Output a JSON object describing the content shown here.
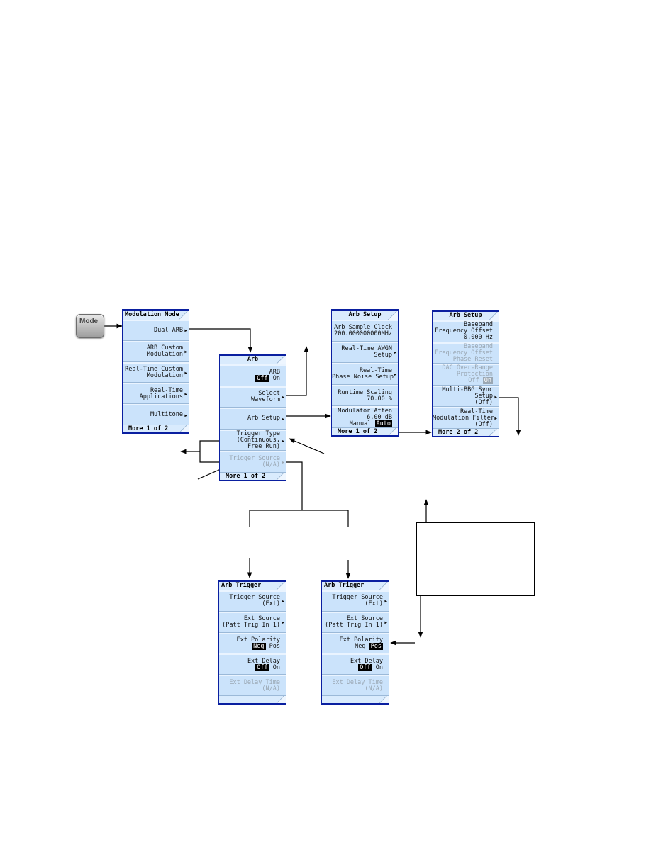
{
  "mode_key": {
    "label": "Mode",
    "icon": "hardkey-button"
  },
  "menus": {
    "modulation_mode": {
      "title": "Modulation Mode",
      "keys": [
        {
          "lines": [
            "Dual ARB"
          ],
          "submenu": true
        },
        {
          "lines": [
            "ARB Custom",
            "Modulation"
          ],
          "submenu": true
        },
        {
          "lines": [
            "Real-Time Custom",
            "Modulation"
          ],
          "submenu": true
        },
        {
          "lines": [
            "Real-Time",
            "Applications"
          ],
          "submenu": true
        },
        {
          "lines": [
            "Multitone"
          ],
          "submenu": true
        }
      ],
      "footer": "More 1 of 2"
    },
    "arb": {
      "title": "Arb",
      "keys": [
        {
          "label": "ARB",
          "toggle": [
            "Off",
            "On"
          ],
          "selected": "Off"
        },
        {
          "lines": [
            "Select",
            "Waveform"
          ],
          "submenu": true
        },
        {
          "lines": [
            "Arb Setup"
          ],
          "submenu": true
        },
        {
          "lines": [
            "Trigger Type",
            "(Continuous,",
            "Free Run)"
          ],
          "submenu": true
        },
        {
          "lines": [
            "Trigger Source",
            "(N/A)"
          ],
          "submenu": true,
          "disabled": true
        }
      ],
      "footer": "More 1 of 2"
    },
    "arb_setup_1": {
      "title": "Arb Setup",
      "keys": [
        {
          "lines": [
            "Arb Sample Clock",
            "200.000000000MHz"
          ]
        },
        {
          "lines": [
            "Real-Time AWGN",
            "Setup"
          ],
          "submenu": true
        },
        {
          "lines": [
            "Real-Time",
            "Phase Noise Setup"
          ],
          "submenu": true
        },
        {
          "lines": [
            "Runtime Scaling",
            "70.00 %"
          ]
        },
        {
          "lines": [
            "Modulator Atten",
            "6.00 dB"
          ],
          "toggle": [
            "Manual",
            "Auto"
          ],
          "selected": "Auto"
        }
      ],
      "footer": "More 1 of 2"
    },
    "arb_setup_2": {
      "title": "Arb Setup",
      "keys": [
        {
          "lines": [
            "Baseband",
            "Frequency Offset",
            "0.000 Hz"
          ]
        },
        {
          "lines": [
            "Baseband",
            "Frequency Offset",
            "Phase Reset"
          ],
          "disabled": true
        },
        {
          "lines": [
            "DAC Over-Range",
            "Protection"
          ],
          "toggle": [
            "Off",
            "On"
          ],
          "selected": "On",
          "disabled": true
        },
        {
          "lines": [
            "Multi-BBG Sync",
            "Setup",
            "(Off)"
          ],
          "submenu": true
        },
        {
          "lines": [
            "Real-Time",
            "Modulation Filter",
            "(Off)"
          ],
          "submenu": true
        }
      ],
      "footer": "More 2 of 2"
    },
    "arb_trigger_a": {
      "title": "Arb Trigger",
      "keys": [
        {
          "lines": [
            "Trigger Source",
            "(Ext)"
          ],
          "submenu": true
        },
        {
          "lines": [
            "Ext Source",
            "(Patt Trig In 1)"
          ],
          "submenu": true
        },
        {
          "lines": [
            "Ext Polarity"
          ],
          "toggle": [
            "Neg",
            "Pos"
          ],
          "selected": "Neg"
        },
        {
          "lines": [
            "Ext Delay"
          ],
          "toggle": [
            "Off",
            "On"
          ],
          "selected": "Off"
        },
        {
          "lines": [
            "Ext Delay Time",
            "(N/A)"
          ],
          "disabled": true
        }
      ],
      "footer": ""
    },
    "arb_trigger_b": {
      "title": "Arb Trigger",
      "keys": [
        {
          "lines": [
            "Trigger Source",
            "(Ext)"
          ],
          "submenu": true
        },
        {
          "lines": [
            "Ext Source",
            "(Patt Trig In 1)"
          ],
          "submenu": true
        },
        {
          "lines": [
            "Ext Polarity"
          ],
          "toggle": [
            "Neg",
            "Pos"
          ],
          "selected": "Pos"
        },
        {
          "lines": [
            "Ext Delay"
          ],
          "toggle": [
            "Off",
            "On"
          ],
          "selected": "Off"
        },
        {
          "lines": [
            "Ext Delay Time",
            "(N/A)"
          ],
          "disabled": true
        }
      ],
      "footer": ""
    }
  },
  "colors": {
    "softkey_bg": "#cbe3fb",
    "menu_border": "#0a1fa0",
    "disabled_text": "#9aa7b3",
    "connector": "#000000"
  }
}
